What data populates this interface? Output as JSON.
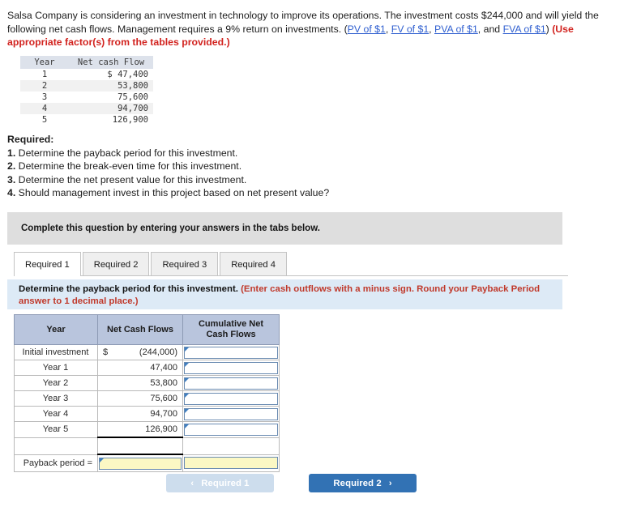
{
  "problem": {
    "part1": "Salsa Company is considering an investment in technology to improve its operations. The investment costs $244,000 and will yield the following net cash flows. Management requires a 9% return on investments. (",
    "link1": "PV of $1",
    "sep1": ", ",
    "link2": "FV of $1",
    "sep2": ", ",
    "link3": "PVA of $1",
    "sep3": ", and ",
    "link4": "FVA of $1",
    "part2": ") ",
    "emphasis": "(Use appropriate factor(s) from the tables provided.)"
  },
  "given_table": {
    "headers": [
      "Year",
      "Net cash Flow"
    ],
    "rows": [
      {
        "year": "1",
        "flow": "$ 47,400"
      },
      {
        "year": "2",
        "flow": "53,800"
      },
      {
        "year": "3",
        "flow": "75,600"
      },
      {
        "year": "4",
        "flow": "94,700"
      },
      {
        "year": "5",
        "flow": "126,900"
      }
    ]
  },
  "required": {
    "heading": "Required:",
    "items": [
      {
        "num": "1.",
        "text": " Determine the payback period for this investment."
      },
      {
        "num": "2.",
        "text": " Determine the break-even time for this investment."
      },
      {
        "num": "3.",
        "text": " Determine the net present value for this investment."
      },
      {
        "num": "4.",
        "text": " Should management invest in this project based on net present value?"
      }
    ]
  },
  "banner": {
    "text": "Complete this question by entering your answers in the tabs below."
  },
  "tabs": [
    {
      "label": "Required 1",
      "active": true
    },
    {
      "label": "Required 2",
      "active": false
    },
    {
      "label": "Required 3",
      "active": false
    },
    {
      "label": "Required 4",
      "active": false
    }
  ],
  "sub_instruction": {
    "main": "Determine the payback period for this investment. ",
    "hint": "(Enter cash outflows with a minus sign. Round your Payback Period answer to 1 decimal place.)"
  },
  "answer_table": {
    "headers": [
      "Year",
      "Net Cash Flows",
      "Cumulative Net Cash Flows"
    ],
    "rows": [
      {
        "label": "Initial investment",
        "symbol": "$",
        "flow": "(244,000)",
        "cumulative": ""
      },
      {
        "label": "Year 1",
        "symbol": "",
        "flow": "47,400",
        "cumulative": ""
      },
      {
        "label": "Year 2",
        "symbol": "",
        "flow": "53,800",
        "cumulative": ""
      },
      {
        "label": "Year 3",
        "symbol": "",
        "flow": "75,600",
        "cumulative": ""
      },
      {
        "label": "Year 4",
        "symbol": "",
        "flow": "94,700",
        "cumulative": ""
      },
      {
        "label": "Year 5",
        "symbol": "",
        "flow": "126,900",
        "cumulative": ""
      }
    ],
    "payback_label": "Payback period =",
    "payback_value": "",
    "payback_value2": ""
  },
  "nav": {
    "prev_label": "Required 1",
    "next_label": "Required 2",
    "prev_chevron": "‹",
    "next_chevron": "›"
  },
  "colors": {
    "accent_blue": "#3272b4",
    "disabled_blue": "#cddded",
    "header_blue": "#b9c5dd",
    "banner_grey": "#dedede",
    "instruction_blue": "#ddeaf6",
    "hint_red": "#c0392b",
    "link_blue": "#2f5fd0",
    "input_yellow": "#fbf8c4"
  }
}
